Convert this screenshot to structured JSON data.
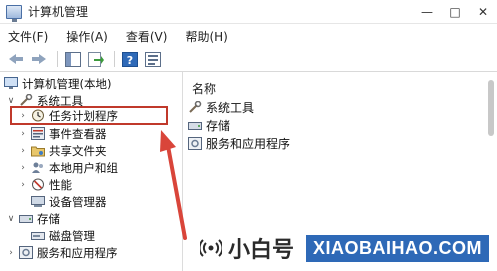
{
  "window": {
    "title": "计算机管理"
  },
  "menu": {
    "items": [
      "文件(F)",
      "操作(A)",
      "查看(V)",
      "帮助(H)"
    ]
  },
  "tree": {
    "root": "计算机管理(本地)",
    "system_tools": "系统工具",
    "task_scheduler": "任务计划程序",
    "event_viewer": "事件查看器",
    "shared_folders": "共享文件夹",
    "local_users": "本地用户和组",
    "performance": "性能",
    "device_manager": "设备管理器",
    "storage": "存储",
    "disk_management": "磁盘管理",
    "services_apps": "服务和应用程序"
  },
  "list": {
    "header": "名称",
    "items": [
      "系统工具",
      "存储",
      "服务和应用程序"
    ]
  },
  "watermark": {
    "cn": "小白号",
    "small": "@小白号",
    "en": "XIAOBAIHAO.COM"
  },
  "colors": {
    "highlight": "#c0392b",
    "arrow": "#d9453a",
    "brand_blue": "#2e69b7"
  }
}
